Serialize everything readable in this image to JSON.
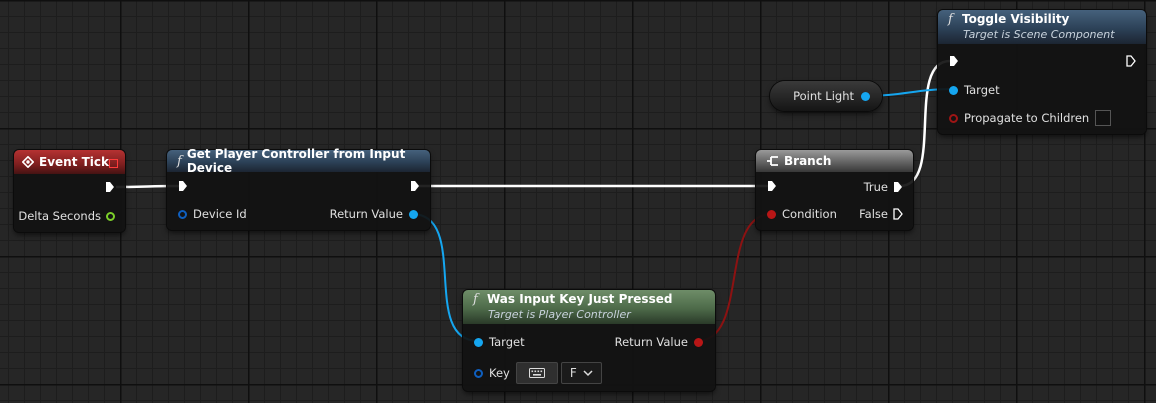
{
  "nodes": {
    "event_tick": {
      "title": "Event Tick",
      "pins": {
        "delta_seconds": "Delta Seconds"
      }
    },
    "get_player_controller": {
      "title": "Get Player Controller from Input Device",
      "pins": {
        "device_id": "Device Id",
        "return_value": "Return Value"
      }
    },
    "was_input_key_just_pressed": {
      "title": "Was Input Key Just Pressed",
      "subtitle": "Target is Player Controller",
      "pins": {
        "target": "Target",
        "return_value": "Return Value",
        "key": "Key"
      },
      "key_value": "F"
    },
    "branch": {
      "title": "Branch",
      "pins": {
        "condition": "Condition",
        "true": "True",
        "false": "False"
      }
    },
    "point_light": {
      "label": "Point Light"
    },
    "toggle_visibility": {
      "title": "Toggle Visibility",
      "subtitle": "Target is Scene Component",
      "pins": {
        "target": "Target",
        "propagate": "Propagate to Children"
      }
    }
  },
  "icons": {
    "function": "function-icon",
    "event": "event-diamond-icon",
    "branch": "branch-icon",
    "exec": "exec-pin-icon",
    "keyboard": "keyboard-icon",
    "dropdown": "chevron-down-icon"
  },
  "colors": {
    "exec_wire": "#ffffff",
    "object_wire": "#15a6f0",
    "bool_wire": "#8c1212",
    "float_pin": "#7ccf2a",
    "event_header": "#8b2222",
    "function_header": "#344b63",
    "pure_function_header": "#56744f",
    "branch_header": "#6e6e6e"
  }
}
